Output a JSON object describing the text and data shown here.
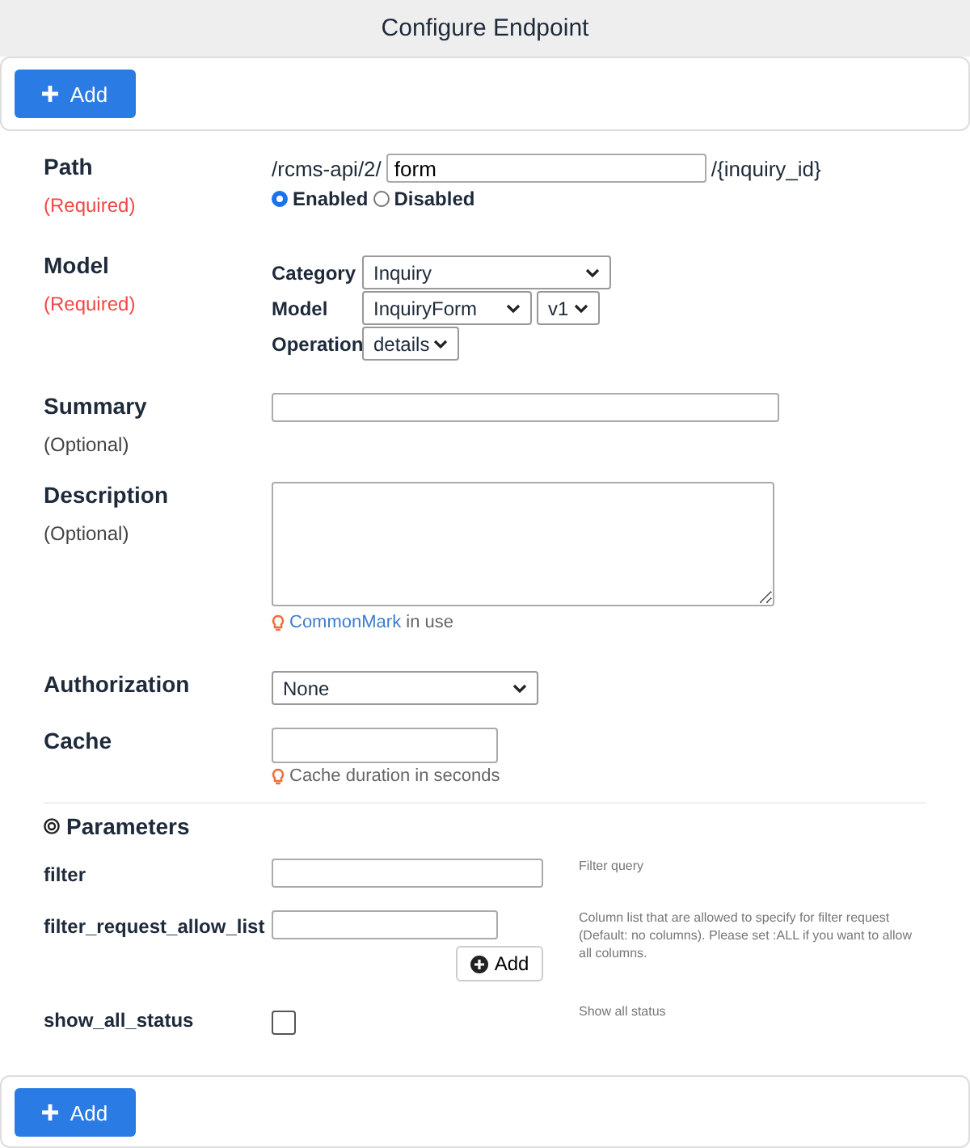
{
  "window": {
    "title": "Configure Endpoint"
  },
  "top_button": {
    "label": "Add"
  },
  "path": {
    "label": "Path",
    "note": "(Required)",
    "prefix": "/rcms-api/2/",
    "value": "form",
    "suffix": "/{inquiry_id}",
    "status": [
      {
        "label": "Enabled",
        "selected": true
      },
      {
        "label": "Disabled",
        "selected": false
      }
    ]
  },
  "model": {
    "label": "Model",
    "note": "(Required)",
    "category": {
      "label": "Category",
      "value": "Inquiry"
    },
    "model": {
      "label": "Model",
      "value": "InquiryForm",
      "version": "v1"
    },
    "operation": {
      "label": "Operation",
      "value": "details"
    }
  },
  "summary": {
    "label": "Summary",
    "note": "(Optional)"
  },
  "description": {
    "label": "Description",
    "note": "(Optional)",
    "hint_link": "CommonMark",
    "hint_text": "in use"
  },
  "authorization": {
    "label": "Authorization",
    "value": "None"
  },
  "cache": {
    "label": "Cache",
    "hint": "Cache duration in seconds"
  },
  "parameters": {
    "title": "Parameters",
    "items": [
      {
        "name": "filter",
        "kind": "text",
        "help": "Filter query"
      },
      {
        "name": "filter_request_allow_list",
        "kind": "list",
        "help": "Column list that are allowed to specify for filter request (Default: no columns). Please set :ALL if you want to allow all columns.",
        "add_label": "Add"
      },
      {
        "name": "show_all_status",
        "kind": "checkbox",
        "checked": false,
        "help": "Show all status"
      }
    ]
  },
  "bottom_button": {
    "label": "Add"
  }
}
